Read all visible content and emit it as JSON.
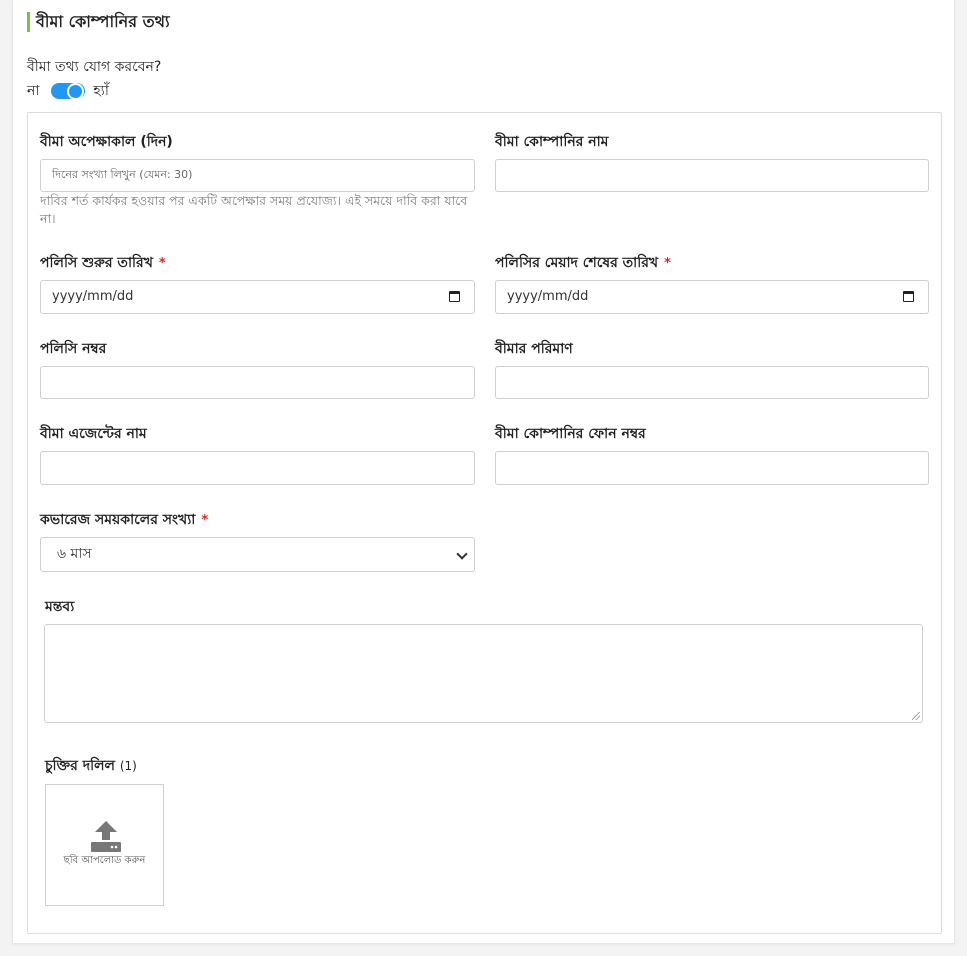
{
  "section": {
    "title": "বীমা কোম্পানির তথ্য",
    "question": "বীমা তথ্য যোগ করবেন?",
    "toggle": {
      "off_label": "না",
      "on_label": "হ্যাঁ",
      "state": "on"
    }
  },
  "fields": {
    "waiting_period": {
      "label": "বীমা অপেক্ষাকাল (দিন)",
      "placeholder": "দিনের সংখ্যা লিখুন (যেমন: 30)",
      "help": "দাবির শর্ত কার্যকর হওয়ার পর একটি অপেক্ষার সময় প্রযোজ্য। এই সময়ে দাবি করা যাবে না।"
    },
    "company_name": {
      "label": "বীমা কোম্পানির নাম",
      "value": ""
    },
    "policy_start": {
      "label": "পলিসি শুরুর তারিখ",
      "required_mark": "*",
      "placeholder": "yyyy/mm/dd"
    },
    "policy_end": {
      "label": "পলিসির মেয়াদ শেষের তারিখ",
      "required_mark": "*",
      "placeholder": "yyyy/mm/dd"
    },
    "policy_number": {
      "label": "পলিসি নম্বর",
      "value": ""
    },
    "insurance_amount": {
      "label": "বীমার পরিমাণ",
      "value": ""
    },
    "agent_name": {
      "label": "বীমা এজেন্টের নাম",
      "value": ""
    },
    "company_phone": {
      "label": "বীমা কোম্পানির ফোন নম্বর",
      "value": ""
    },
    "coverage_periods": {
      "label": "কভারেজ সময়কালের সংখ্যা",
      "required_mark": "*",
      "selected": "৬ মাস"
    },
    "remarks": {
      "label": "মন্তব্য",
      "value": ""
    },
    "contract_document": {
      "label": "চুক্তির দলিল",
      "count": "(1)",
      "upload_text": "ছবি আপলোড করুন"
    }
  },
  "colors": {
    "accent_bar": "#7cc242",
    "toggle": "#2196f3",
    "required": "#e02424"
  },
  "icons": {
    "upload": "upload-icon",
    "calendar": "calendar-icon",
    "select": "chevron-down-icon"
  }
}
